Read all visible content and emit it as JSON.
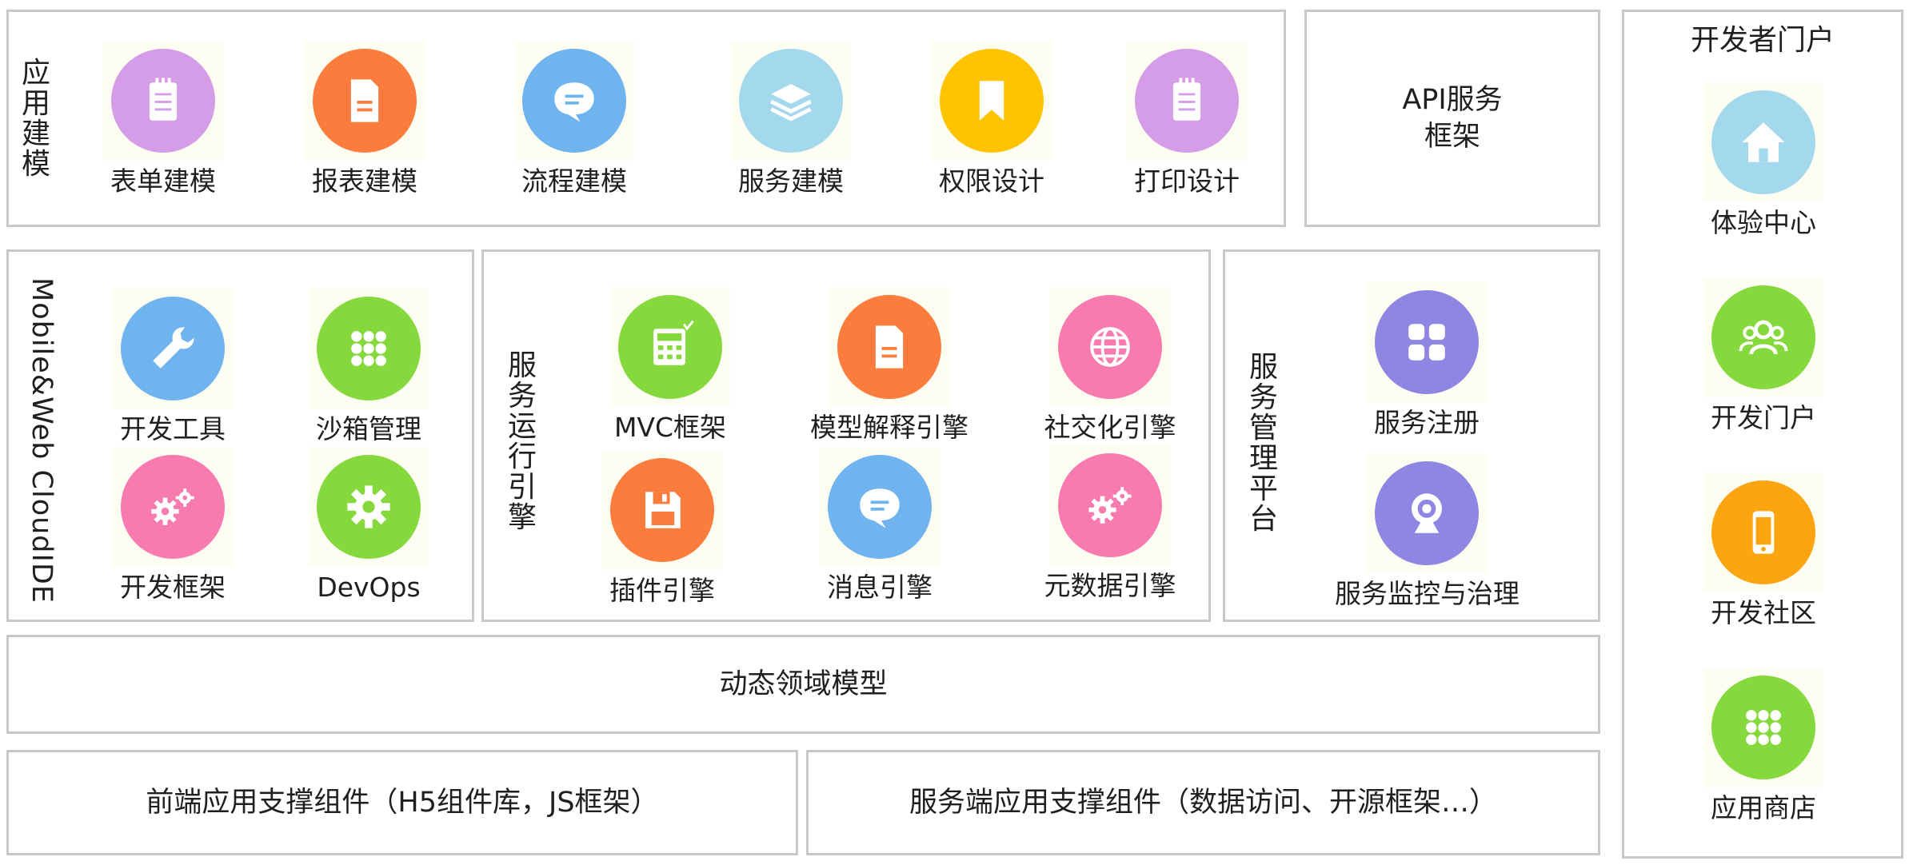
{
  "app_modeling": {
    "title": "应用建模",
    "items": [
      {
        "label": "表单建模",
        "icon": "notepad-icon",
        "color": "#d59ce8"
      },
      {
        "label": "报表建模",
        "icon": "document-icon",
        "color": "#fb7c3c"
      },
      {
        "label": "流程建模",
        "icon": "chat-bubble-icon",
        "color": "#6fb4ef"
      },
      {
        "label": "服务建模",
        "icon": "layers-icon",
        "color": "#a4d8ec"
      },
      {
        "label": "权限设计",
        "icon": "bookmark-icon",
        "color": "#ffc300"
      },
      {
        "label": "打印设计",
        "icon": "notepad-icon",
        "color": "#d59ce8"
      }
    ]
  },
  "api_framework": {
    "line1": "API服务",
    "line2": "框架"
  },
  "developer_portal": {
    "title": "开发者门户",
    "items": [
      {
        "label": "体验中心",
        "icon": "home-icon",
        "color": "#a4d8ec"
      },
      {
        "label": "开发门户",
        "icon": "users-icon",
        "color": "#86d93d"
      },
      {
        "label": "开发社区",
        "icon": "smartphone-icon",
        "color": "#fca511"
      },
      {
        "label": "应用商店",
        "icon": "grid-icon",
        "color": "#86d93d"
      }
    ]
  },
  "cloud_ide": {
    "title": "Mobile&Web CloudIDE",
    "items": [
      {
        "label": "开发工具",
        "icon": "wrench-icon",
        "color": "#6fb4ef"
      },
      {
        "label": "沙箱管理",
        "icon": "grid-icon",
        "color": "#86d93d"
      },
      {
        "label": "开发框架",
        "icon": "gears-icon",
        "color": "#f77bae"
      },
      {
        "label": "DevOps",
        "icon": "gear-icon",
        "color": "#86d93d"
      }
    ]
  },
  "runtime_engine": {
    "title": "服务运行引擎",
    "items": [
      {
        "label": "MVC框架",
        "icon": "calculator-icon",
        "color": "#86d93d"
      },
      {
        "label": "模型解释引擎",
        "icon": "document-icon",
        "color": "#fb7c3c"
      },
      {
        "label": "社交化引擎",
        "icon": "globe-icon",
        "color": "#f77bae"
      },
      {
        "label": "插件引擎",
        "icon": "floppy-icon",
        "color": "#fb7c3c"
      },
      {
        "label": "消息引擎",
        "icon": "chat-bubble-icon",
        "color": "#6fb4ef"
      },
      {
        "label": "元数据引擎",
        "icon": "gears-icon",
        "color": "#f77bae"
      }
    ]
  },
  "service_mgmt": {
    "title": "服务管理平台",
    "items": [
      {
        "label": "服务注册",
        "icon": "apps-icon",
        "color": "#8f86e3"
      },
      {
        "label": "服务监控与治理",
        "icon": "webcam-icon",
        "color": "#8f86e3"
      }
    ]
  },
  "domain_model": {
    "label": "动态领域模型"
  },
  "frontend_support": {
    "label": "前端应用支撑组件（H5组件库，JS框架）"
  },
  "backend_support": {
    "label": "服务端应用支撑组件（数据访问、开源框架…）"
  }
}
